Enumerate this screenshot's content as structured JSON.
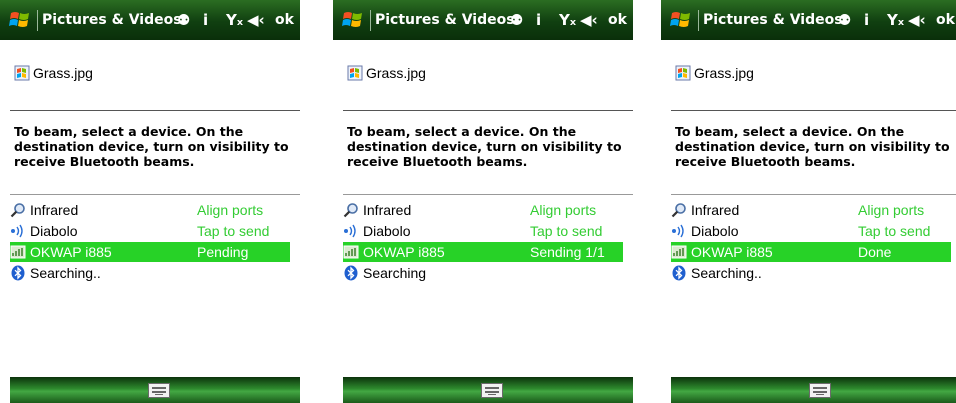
{
  "colors": {
    "titlebar": "#1e5a1a",
    "selection": "#27d227",
    "status_text": "#33cc33"
  },
  "panels": [
    {
      "title": "Pictures & Videos",
      "ok": "ok",
      "file": "Grass.jpg",
      "instruction": "To beam, select a device. On the destination device, turn on visibility to receive Bluetooth beams.",
      "devices": [
        {
          "name": "Infrared",
          "status": "Align ports",
          "icon": "magnifier-icon",
          "selected": false
        },
        {
          "name": "Diabolo",
          "status": "Tap to send",
          "icon": "infrared-icon",
          "selected": false
        },
        {
          "name": "OKWAP i885",
          "status": "Pending",
          "icon": "device-icon",
          "selected": true
        },
        {
          "name": "Searching..",
          "status": "",
          "icon": "bluetooth-icon",
          "selected": false
        }
      ]
    },
    {
      "title": "Pictures & Videos",
      "ok": "ok",
      "file": "Grass.jpg",
      "instruction": "To beam, select a device. On the destination device, turn on visibility to receive Bluetooth beams.",
      "devices": [
        {
          "name": "Infrared",
          "status": "Align ports",
          "icon": "magnifier-icon",
          "selected": false
        },
        {
          "name": "Diabolo",
          "status": "Tap to send",
          "icon": "infrared-icon",
          "selected": false
        },
        {
          "name": "OKWAP i885",
          "status": "Sending 1/1",
          "icon": "device-icon",
          "selected": true
        },
        {
          "name": "Searching",
          "status": "",
          "icon": "bluetooth-icon",
          "selected": false
        }
      ]
    },
    {
      "title": "Pictures & Videos",
      "ok": "ok",
      "file": "Grass.jpg",
      "instruction": "To beam, select a device. On the destination device, turn on visibility to receive Bluetooth beams.",
      "devices": [
        {
          "name": "Infrared",
          "status": "Align ports",
          "icon": "magnifier-icon",
          "selected": false
        },
        {
          "name": "Diabolo",
          "status": "Tap to send",
          "icon": "infrared-icon",
          "selected": false
        },
        {
          "name": "OKWAP i885",
          "status": "Done",
          "icon": "device-icon",
          "selected": true
        },
        {
          "name": "Searching..",
          "status": "",
          "icon": "bluetooth-icon",
          "selected": false
        }
      ]
    }
  ]
}
